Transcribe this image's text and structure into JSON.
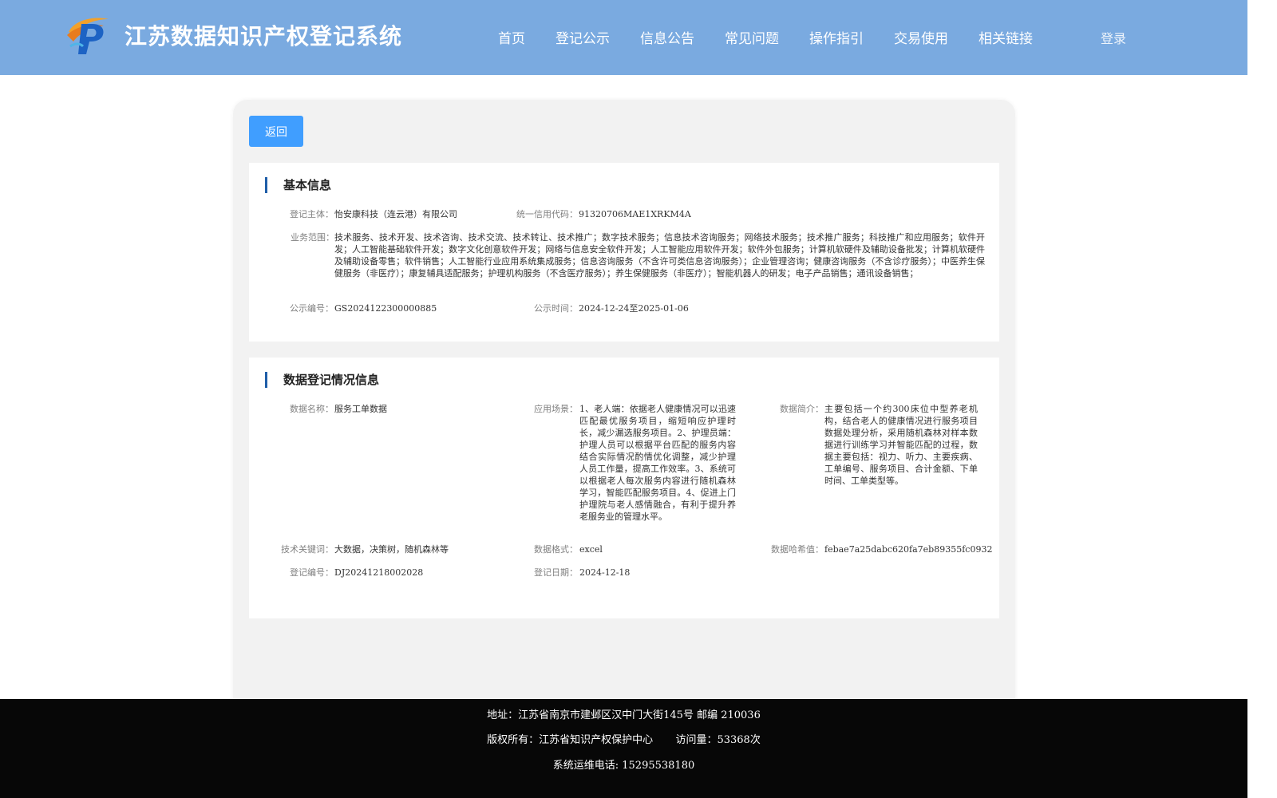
{
  "site": {
    "title": "江苏数据知识产权登记系统",
    "logo_icon": "jsip-logo-icon"
  },
  "nav": {
    "items": [
      {
        "label": "首页"
      },
      {
        "label": "登记公示"
      },
      {
        "label": "信息公告"
      },
      {
        "label": "常见问题"
      },
      {
        "label": "操作指引"
      },
      {
        "label": "交易使用"
      },
      {
        "label": "相关链接"
      }
    ],
    "login": "登录"
  },
  "actions": {
    "back": "返回"
  },
  "basic_info": {
    "title": "基本信息",
    "subject_label": "登记主体：",
    "subject": "怡安康科技（连云港）有限公司",
    "credit_code_label": "统一信用代码：",
    "credit_code": "91320706MAE1XRKM4A",
    "scope_label": "业务范围：",
    "scope": "技术服务、技术开发、技术咨询、技术交流、技术转让、技术推广；数字技术服务；信息技术咨询服务；网络技术服务；技术推广服务；科技推广和应用服务；软件开发；人工智能基础软件开发；数字文化创意软件开发；网络与信息安全软件开发；人工智能应用软件开发；软件外包服务；计算机软硬件及辅助设备批发；计算机软硬件及辅助设备零售；软件销售；人工智能行业应用系统集成服务；信息咨询服务（不含许可类信息咨询服务）；企业管理咨询；健康咨询服务（不含诊疗服务）；中医养生保健服务（非医疗）；康复辅具适配服务；护理机构服务（不含医疗服务）；养生保健服务（非医疗）；智能机器人的研发；电子产品销售；通讯设备销售；",
    "notice_no_label": "公示编号：",
    "notice_no": "GS2024122300000885",
    "notice_time_label": "公示时间：",
    "notice_time": "2024-12-24至2025-01-06"
  },
  "data_info": {
    "title": "数据登记情况信息",
    "name_label": "数据名称：",
    "name": "服务工单数据",
    "scenario_label": "应用场景：",
    "scenario": "1、老人端：依据老人健康情况可以迅速匹配最优服务项目，缩短响应护理时长，减少漏选服务项目。2、护理员端：护理人员可以根据平台匹配的服务内容结合实际情况酌情优化调整，减少护理人员工作量，提高工作效率。3、系统可以根据老人每次服务内容进行随机森林学习，智能匹配服务项目。4、促进上门护理院与老人感情融合，有利于提升养老服务业的管理水平。",
    "intro_label": "数据简介：",
    "intro": "主要包括一个约300床位中型养老机构，结合老人的健康情况进行服务项目数据处理分析，采用随机森林对样本数据进行训练学习并智能匹配的过程，数据主要包括：视力、听力、主要疾病、工单编号、服务项目、合计金额、下单时间、工单类型等。",
    "keywords_label": "技术关键词：",
    "keywords": "大数据，决策树，随机森林等",
    "format_label": "数据格式：",
    "format": "excel",
    "hash_label": "数据哈希值：",
    "hash": "febae7a25dabc620fa7eb89355fc0932",
    "reg_no_label": "登记编号：",
    "reg_no": "DJ20241218002028",
    "reg_date_label": "登记日期：",
    "reg_date": "2024-12-18"
  },
  "footer": {
    "address": "地址：江苏省南京市建邺区汉中门大街145号 邮编 210036",
    "copyright": "版权所有：江苏省知识产权保护中心",
    "visits": "访问量：53368次",
    "hotline": "系统运维电话: 15295538180"
  },
  "colors": {
    "header_bg": "#7aaae0",
    "accent_button": "#409eff",
    "section_bar": "#1f5ea8",
    "footer_bg": "#070707"
  }
}
